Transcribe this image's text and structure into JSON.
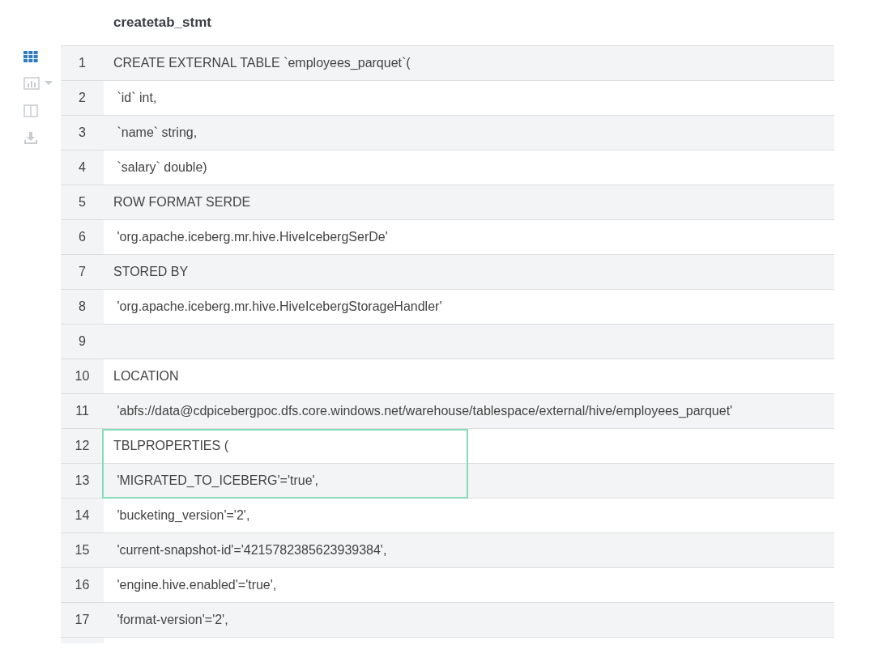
{
  "toolbar": {
    "items": [
      {
        "kind": "grid",
        "selected": true
      },
      {
        "kind": "chart",
        "selected": false
      },
      {
        "kind": "columns",
        "selected": false
      },
      {
        "kind": "download",
        "selected": false
      }
    ]
  },
  "table": {
    "column": "createtab_stmt",
    "rows": [
      {
        "number": "1",
        "text": "CREATE EXTERNAL TABLE `employees_parquet`(",
        "highlighted": false
      },
      {
        "number": "2",
        "text": " `id` int,",
        "highlighted": false
      },
      {
        "number": "3",
        "text": " `name` string,",
        "highlighted": false
      },
      {
        "number": "4",
        "text": " `salary` double)",
        "highlighted": false
      },
      {
        "number": "5",
        "text": "ROW FORMAT SERDE",
        "highlighted": false
      },
      {
        "number": "6",
        "text": " 'org.apache.iceberg.mr.hive.HiveIcebergSerDe'",
        "highlighted": false
      },
      {
        "number": "7",
        "text": "STORED BY",
        "highlighted": false
      },
      {
        "number": "8",
        "text": " 'org.apache.iceberg.mr.hive.HiveIcebergStorageHandler'",
        "highlighted": false
      },
      {
        "number": "9",
        "text": "",
        "highlighted": false
      },
      {
        "number": "10",
        "text": "LOCATION",
        "highlighted": false
      },
      {
        "number": "11",
        "text": " 'abfs://data@cdpicebergpoc.dfs.core.windows.net/warehouse/tablespace/external/hive/employees_parquet'",
        "highlighted": false
      },
      {
        "number": "12",
        "text": "TBLPROPERTIES (",
        "highlighted": true
      },
      {
        "number": "13",
        "text": " 'MIGRATED_TO_ICEBERG'='true',",
        "highlighted": true
      },
      {
        "number": "14",
        "text": " 'bucketing_version'='2',",
        "highlighted": false
      },
      {
        "number": "15",
        "text": " 'current-snapshot-id'='4215782385623939384',",
        "highlighted": false
      },
      {
        "number": "16",
        "text": " 'engine.hive.enabled'='true',",
        "highlighted": false
      },
      {
        "number": "17",
        "text": " 'format-version'='2',",
        "highlighted": false
      }
    ]
  }
}
